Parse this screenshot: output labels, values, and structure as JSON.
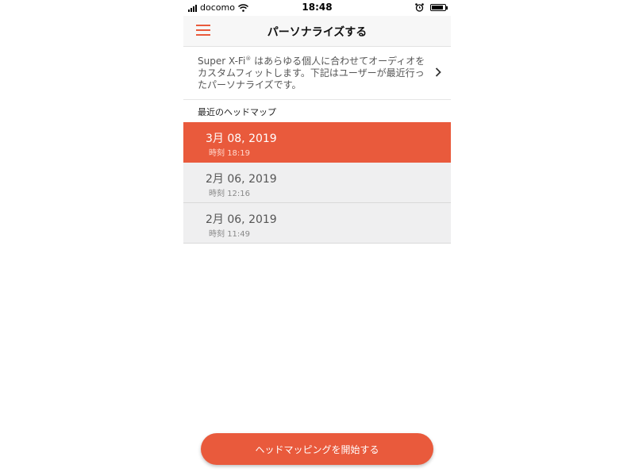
{
  "status_bar": {
    "carrier": "docomo",
    "time": "18:48",
    "signal_icon": "signal-bars-icon",
    "wifi_icon": "wifi-icon",
    "alarm_icon": "alarm-clock-icon",
    "battery_icon": "battery-icon",
    "battery_level": 0.9
  },
  "nav": {
    "title": "パーソナライズする",
    "menu_icon": "hamburger-menu-icon"
  },
  "intro": {
    "brand": "Super X-Fi",
    "registered_mark": "®",
    "text": " はあらゆる個人に合わせてオーディオをカスタムフィットします。下記はユーザーが最近行ったパーソナライズです。"
  },
  "section": {
    "title": "最近のヘッドマップ"
  },
  "head_maps": {
    "time_label": "時刻",
    "items": [
      {
        "date": "3月 08, 2019",
        "time": "18:19",
        "selected": true
      },
      {
        "date": "2月 06, 2019",
        "time": "12:16",
        "selected": false
      },
      {
        "date": "2月 06, 2019",
        "time": "11:49",
        "selected": false
      }
    ]
  },
  "start_button": {
    "label": "ヘッドマッピングを開始する"
  },
  "colors": {
    "accent": "#e95a3c",
    "row_bg": "#efeff0",
    "nav_bg": "#f7f7f7"
  }
}
